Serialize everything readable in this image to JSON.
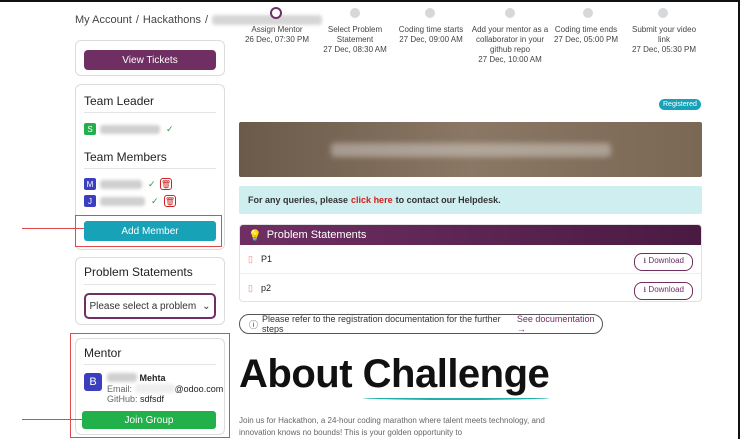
{
  "breadcrumb": {
    "account": "My Account",
    "sep": "/",
    "hackathons": "Hackathons",
    "sep2": "/"
  },
  "sidebar": {
    "view_tickets": "View Tickets",
    "team_leader": "Team Leader",
    "leader_initial": "S",
    "team_members": "Team Members",
    "member1_initial": "M",
    "member2_initial": "J",
    "add_member": "Add Member",
    "problem_statements": "Problem Statements",
    "select_placeholder": "Please select a problem",
    "mentor": "Mentor",
    "mentor_initial": "B",
    "mentor_name": "Mehta",
    "mentor_email_label": "Email:",
    "mentor_email": "@odoo.com",
    "mentor_github_label": "GitHub:",
    "mentor_github": "sdfsdf",
    "join_group": "Join Group"
  },
  "timeline": [
    {
      "title": "Assign Mentor",
      "date": "26 Dec, 07:30 PM"
    },
    {
      "title": "Select Problem Statement",
      "date": "27 Dec, 08:30 AM"
    },
    {
      "title": "Coding time starts",
      "date": "27 Dec, 09:00 AM"
    },
    {
      "title": "Add your mentor as a collaborator in your github repo",
      "date": "27 Dec, 10:00 AM"
    },
    {
      "title": "Coding time ends",
      "date": "27 Dec, 05:00 PM"
    },
    {
      "title": "Submit your video link",
      "date": "27 Dec, 05:30 PM"
    }
  ],
  "status_badge": "Registered",
  "info": {
    "pre": "For any queries, please",
    "link": "click here",
    "post": "to contact our Helpdesk."
  },
  "problems": {
    "heading": "Problem Statements",
    "rows": [
      {
        "name": "P1",
        "action": "Download"
      },
      {
        "name": "p2",
        "action": "Download"
      }
    ]
  },
  "notice": {
    "text": "Please refer to the registration documentation for the further steps",
    "link": "See documentation"
  },
  "about": {
    "word1": "About",
    "word2": "Challenge"
  },
  "description": "Join us for Hackathon, a 24-hour coding marathon where talent meets technology, and innovation knows no bounds! This is your golden opportunity to",
  "colors": {
    "primary": "#6f2f63",
    "teal": "#17a2b8",
    "green": "#22b04b",
    "annotation": "#e04a4a"
  }
}
